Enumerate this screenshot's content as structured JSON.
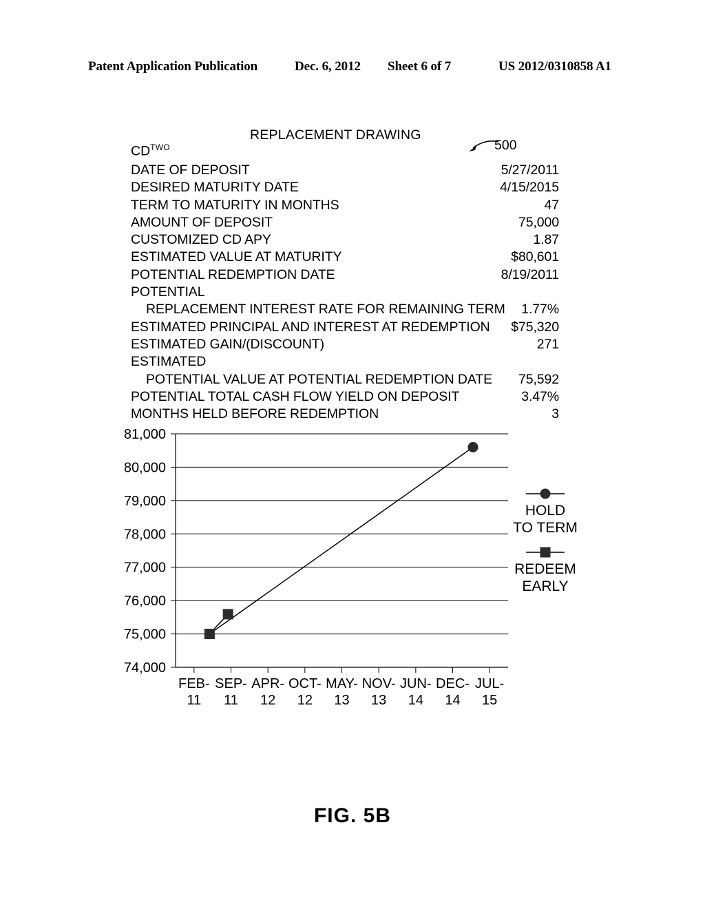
{
  "header": {
    "publication": "Patent Application Publication",
    "date": "Dec. 6, 2012",
    "sheet": "Sheet 6 of 7",
    "number": "US 2012/0310858 A1"
  },
  "figure": {
    "replacement_title": "REPLACEMENT DRAWING",
    "cd_label_base": "CD",
    "cd_label_sup": "TWO",
    "reference_numeral": "500",
    "caption": "FIG. 5B"
  },
  "table": {
    "rows": [
      {
        "label": "DATE OF DEPOSIT",
        "value": "5/27/2011",
        "indent": false
      },
      {
        "label": "DESIRED MATURITY DATE",
        "value": "4/15/2015",
        "indent": false
      },
      {
        "label": "TERM TO MATURITY IN MONTHS",
        "value": "47",
        "indent": false
      },
      {
        "label": "AMOUNT OF DEPOSIT",
        "value": "75,000",
        "indent": false
      },
      {
        "label": "CUSTOMIZED CD APY",
        "value": "1.87",
        "indent": false
      },
      {
        "label": "ESTIMATED VALUE AT MATURITY",
        "value": "$80,601",
        "indent": false
      },
      {
        "label": "POTENTIAL REDEMPTION DATE",
        "value": "8/19/2011",
        "indent": false
      },
      {
        "label": "POTENTIAL",
        "value": "",
        "indent": false
      },
      {
        "label": "REPLACEMENT INTEREST RATE FOR REMAINING TERM",
        "value": "1.77%",
        "indent": true
      },
      {
        "label": "ESTIMATED PRINCIPAL AND INTEREST AT REDEMPTION",
        "value": "$75,320",
        "indent": false
      },
      {
        "label": "ESTIMATED GAIN/(DISCOUNT)",
        "value": "271",
        "indent": false
      },
      {
        "label": "ESTIMATED",
        "value": "",
        "indent": false
      },
      {
        "label": "POTENTIAL VALUE AT POTENTIAL REDEMPTION DATE",
        "value": "75,592",
        "indent": true
      },
      {
        "label": "POTENTIAL TOTAL CASH FLOW YIELD ON DEPOSIT",
        "value": "3.47%",
        "indent": false
      },
      {
        "label": "MONTHS HELD BEFORE REDEMPTION",
        "value": "3",
        "indent": false
      }
    ]
  },
  "chart_data": {
    "type": "line",
    "title": "",
    "xlabel": "",
    "ylabel": "",
    "ylim": [
      74000,
      81000
    ],
    "ytick_labels": [
      "81,000",
      "80,000",
      "79,000",
      "78,000",
      "77,000",
      "76,000",
      "75,000",
      "74,000"
    ],
    "yticks": [
      81000,
      80000,
      79000,
      78000,
      77000,
      76000,
      75000,
      74000
    ],
    "grid": true,
    "legend_position": "right",
    "categories": [
      "FEB-11",
      "SEP-11",
      "APR-12",
      "OCT-12",
      "MAY-13",
      "NOV-13",
      "JUN-14",
      "DEC-14",
      "JUL-15"
    ],
    "xtick_top": [
      "FEB-",
      "SEP-",
      "APR-",
      "OCT-",
      "MAY-",
      "NOV-",
      "JUN-",
      "DEC-",
      "JUL-"
    ],
    "xtick_bottom": [
      "11",
      "11",
      "12",
      "12",
      "13",
      "13",
      "14",
      "14",
      "15"
    ],
    "series": [
      {
        "name": "HOLD TO TERM",
        "marker": "circle",
        "legend_line_1": "HOLD",
        "legend_line_2": "TO TERM",
        "points": [
          {
            "x": 0.42,
            "y": 75000
          },
          {
            "x": 7.55,
            "y": 80601
          }
        ]
      },
      {
        "name": "REDEEM EARLY",
        "marker": "square",
        "legend_line_1": "REDEEM",
        "legend_line_2": "EARLY",
        "points": [
          {
            "x": 0.42,
            "y": 75000
          },
          {
            "x": 0.92,
            "y": 75592
          }
        ]
      }
    ]
  }
}
